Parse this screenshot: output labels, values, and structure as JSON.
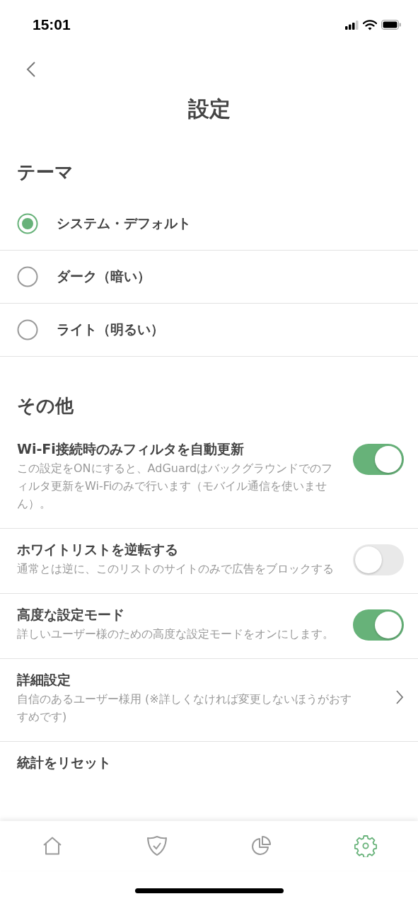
{
  "status_bar": {
    "time": "15:01"
  },
  "header": {
    "title": "設定"
  },
  "theme": {
    "heading": "テーマ",
    "options": [
      {
        "label": "システム・デフォルト",
        "selected": true
      },
      {
        "label": "ダーク（暗い）",
        "selected": false
      },
      {
        "label": "ライト（明るい）",
        "selected": false
      }
    ]
  },
  "other": {
    "heading": "その他",
    "items": [
      {
        "kind": "toggle",
        "title": "Wi-Fi接続時のみフィルタを自動更新",
        "description": "この設定をONにすると、AdGuardはバックグラウンドでのフィルタ更新をWi-Fiのみで行います（モバイル通信を使いません）。",
        "on": true
      },
      {
        "kind": "toggle",
        "title": "ホワイトリストを逆転する",
        "description": "通常とは逆に、このリストのサイトのみで広告をブロックする",
        "on": false
      },
      {
        "kind": "toggle",
        "title": "高度な設定モード",
        "description": "詳しいユーザー様のための高度な設定モードをオンにします。",
        "on": true
      },
      {
        "kind": "link",
        "title": "詳細設定",
        "description": "自信のあるユーザー様用 (※詳しくなければ変更しないほうがおすすめです)"
      },
      {
        "kind": "link",
        "title": "統計をリセット"
      }
    ]
  },
  "tab_bar": {
    "tabs": [
      {
        "kind": "home",
        "selected": false
      },
      {
        "kind": "protection",
        "selected": false
      },
      {
        "kind": "stats",
        "selected": false
      },
      {
        "kind": "settings",
        "selected": true
      }
    ]
  }
}
